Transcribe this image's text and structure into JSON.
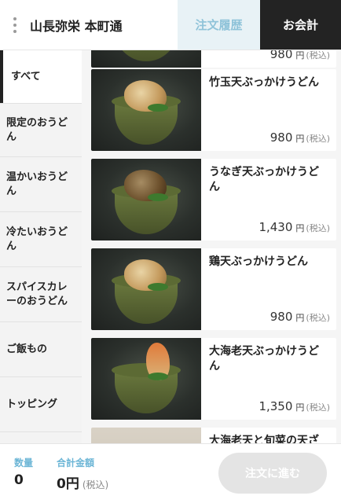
{
  "header": {
    "store_name": "山長弥栄 本町通",
    "order_history_label": "注文履歴",
    "checkout_label": "お会計"
  },
  "sidebar": {
    "categories": [
      {
        "label": "すべて",
        "active": true
      },
      {
        "label": "限定のおうどん"
      },
      {
        "label": "温かいおうどん"
      },
      {
        "label": "冷たいおうどん"
      },
      {
        "label": "スパイスカレーのおうどん"
      },
      {
        "label": "ご飯もの"
      },
      {
        "label": "トッピング"
      }
    ]
  },
  "products": [
    {
      "name": "",
      "price": "980",
      "unit": "円",
      "tax": "(税込)"
    },
    {
      "name": "竹玉天ぶっかけうどん",
      "price": "980",
      "unit": "円",
      "tax": "(税込)"
    },
    {
      "name": "うなぎ天ぶっかけうどん",
      "price": "1,430",
      "unit": "円",
      "tax": "(税込)"
    },
    {
      "name": "鶏天ぶっかけうどん",
      "price": "980",
      "unit": "円",
      "tax": "(税込)"
    },
    {
      "name": "大海老天ぶっかけうどん",
      "price": "1,350",
      "unit": "円",
      "tax": "(税込)"
    },
    {
      "name": "大海老天と旬菜の天ざ",
      "price": "",
      "unit": "",
      "tax": ""
    }
  ],
  "footer": {
    "quantity_label": "数量",
    "quantity_value": "0",
    "total_label": "合計金額",
    "total_value": "0円",
    "total_tax": "(税込)",
    "proceed_label": "注文に進む"
  },
  "colors": {
    "accent": "#6db6d6",
    "header_dark": "#232323",
    "history_bg": "#e8f2f6"
  }
}
